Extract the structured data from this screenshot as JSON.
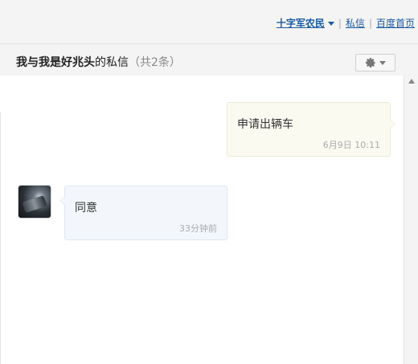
{
  "topnav": {
    "user": "十字军农民",
    "separator": "|",
    "links": [
      "私信",
      "百度首页"
    ]
  },
  "header": {
    "title_part1": "我与",
    "title_name": "我是好兆头",
    "title_part2": "的私信",
    "title_count": "（共2条）"
  },
  "messages": [
    {
      "side": "right",
      "text": "申请出辆车",
      "time": "6月9日  10:11"
    },
    {
      "side": "left",
      "text": "同意",
      "time": "33分钟前",
      "avatar": "user-avatar"
    }
  ],
  "icons": {
    "settings": "gear-icon",
    "dropdown": "chevron-down-icon",
    "scroll_up": "scroll-up-arrow-icon"
  },
  "colors": {
    "link": "#1a5aa0",
    "right_bubble_bg": "#fbfaf1",
    "left_bubble_bg": "#f3f7fc"
  }
}
